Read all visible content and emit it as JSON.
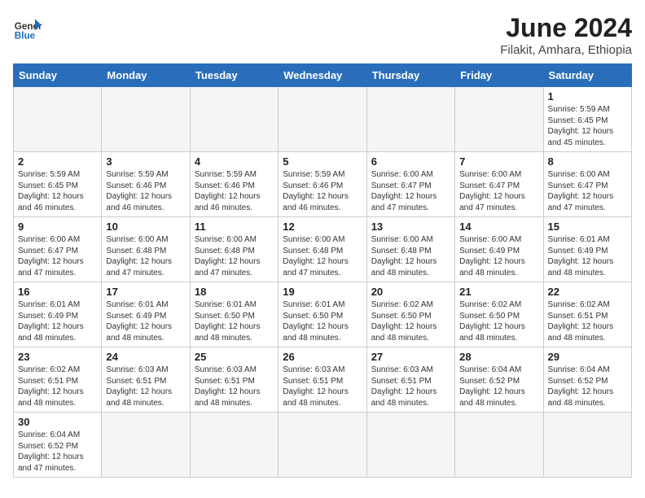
{
  "header": {
    "logo_general": "General",
    "logo_blue": "Blue",
    "title": "June 2024",
    "location": "Filakit, Amhara, Ethiopia"
  },
  "days_of_week": [
    "Sunday",
    "Monday",
    "Tuesday",
    "Wednesday",
    "Thursday",
    "Friday",
    "Saturday"
  ],
  "weeks": [
    [
      {
        "day": "",
        "info": ""
      },
      {
        "day": "",
        "info": ""
      },
      {
        "day": "",
        "info": ""
      },
      {
        "day": "",
        "info": ""
      },
      {
        "day": "",
        "info": ""
      },
      {
        "day": "",
        "info": ""
      },
      {
        "day": "1",
        "info": "Sunrise: 5:59 AM\nSunset: 6:45 PM\nDaylight: 12 hours and 45 minutes."
      }
    ],
    [
      {
        "day": "2",
        "info": "Sunrise: 5:59 AM\nSunset: 6:45 PM\nDaylight: 12 hours and 46 minutes."
      },
      {
        "day": "3",
        "info": "Sunrise: 5:59 AM\nSunset: 6:46 PM\nDaylight: 12 hours and 46 minutes."
      },
      {
        "day": "4",
        "info": "Sunrise: 5:59 AM\nSunset: 6:46 PM\nDaylight: 12 hours and 46 minutes."
      },
      {
        "day": "5",
        "info": "Sunrise: 5:59 AM\nSunset: 6:46 PM\nDaylight: 12 hours and 46 minutes."
      },
      {
        "day": "6",
        "info": "Sunrise: 6:00 AM\nSunset: 6:47 PM\nDaylight: 12 hours and 47 minutes."
      },
      {
        "day": "7",
        "info": "Sunrise: 6:00 AM\nSunset: 6:47 PM\nDaylight: 12 hours and 47 minutes."
      },
      {
        "day": "8",
        "info": "Sunrise: 6:00 AM\nSunset: 6:47 PM\nDaylight: 12 hours and 47 minutes."
      }
    ],
    [
      {
        "day": "9",
        "info": "Sunrise: 6:00 AM\nSunset: 6:47 PM\nDaylight: 12 hours and 47 minutes."
      },
      {
        "day": "10",
        "info": "Sunrise: 6:00 AM\nSunset: 6:48 PM\nDaylight: 12 hours and 47 minutes."
      },
      {
        "day": "11",
        "info": "Sunrise: 6:00 AM\nSunset: 6:48 PM\nDaylight: 12 hours and 47 minutes."
      },
      {
        "day": "12",
        "info": "Sunrise: 6:00 AM\nSunset: 6:48 PM\nDaylight: 12 hours and 47 minutes."
      },
      {
        "day": "13",
        "info": "Sunrise: 6:00 AM\nSunset: 6:48 PM\nDaylight: 12 hours and 48 minutes."
      },
      {
        "day": "14",
        "info": "Sunrise: 6:00 AM\nSunset: 6:49 PM\nDaylight: 12 hours and 48 minutes."
      },
      {
        "day": "15",
        "info": "Sunrise: 6:01 AM\nSunset: 6:49 PM\nDaylight: 12 hours and 48 minutes."
      }
    ],
    [
      {
        "day": "16",
        "info": "Sunrise: 6:01 AM\nSunset: 6:49 PM\nDaylight: 12 hours and 48 minutes."
      },
      {
        "day": "17",
        "info": "Sunrise: 6:01 AM\nSunset: 6:49 PM\nDaylight: 12 hours and 48 minutes."
      },
      {
        "day": "18",
        "info": "Sunrise: 6:01 AM\nSunset: 6:50 PM\nDaylight: 12 hours and 48 minutes."
      },
      {
        "day": "19",
        "info": "Sunrise: 6:01 AM\nSunset: 6:50 PM\nDaylight: 12 hours and 48 minutes."
      },
      {
        "day": "20",
        "info": "Sunrise: 6:02 AM\nSunset: 6:50 PM\nDaylight: 12 hours and 48 minutes."
      },
      {
        "day": "21",
        "info": "Sunrise: 6:02 AM\nSunset: 6:50 PM\nDaylight: 12 hours and 48 minutes."
      },
      {
        "day": "22",
        "info": "Sunrise: 6:02 AM\nSunset: 6:51 PM\nDaylight: 12 hours and 48 minutes."
      }
    ],
    [
      {
        "day": "23",
        "info": "Sunrise: 6:02 AM\nSunset: 6:51 PM\nDaylight: 12 hours and 48 minutes."
      },
      {
        "day": "24",
        "info": "Sunrise: 6:03 AM\nSunset: 6:51 PM\nDaylight: 12 hours and 48 minutes."
      },
      {
        "day": "25",
        "info": "Sunrise: 6:03 AM\nSunset: 6:51 PM\nDaylight: 12 hours and 48 minutes."
      },
      {
        "day": "26",
        "info": "Sunrise: 6:03 AM\nSunset: 6:51 PM\nDaylight: 12 hours and 48 minutes."
      },
      {
        "day": "27",
        "info": "Sunrise: 6:03 AM\nSunset: 6:51 PM\nDaylight: 12 hours and 48 minutes."
      },
      {
        "day": "28",
        "info": "Sunrise: 6:04 AM\nSunset: 6:52 PM\nDaylight: 12 hours and 48 minutes."
      },
      {
        "day": "29",
        "info": "Sunrise: 6:04 AM\nSunset: 6:52 PM\nDaylight: 12 hours and 48 minutes."
      }
    ],
    [
      {
        "day": "30",
        "info": "Sunrise: 6:04 AM\nSunset: 6:52 PM\nDaylight: 12 hours and 47 minutes."
      },
      {
        "day": "",
        "info": ""
      },
      {
        "day": "",
        "info": ""
      },
      {
        "day": "",
        "info": ""
      },
      {
        "day": "",
        "info": ""
      },
      {
        "day": "",
        "info": ""
      },
      {
        "day": "",
        "info": ""
      }
    ]
  ]
}
